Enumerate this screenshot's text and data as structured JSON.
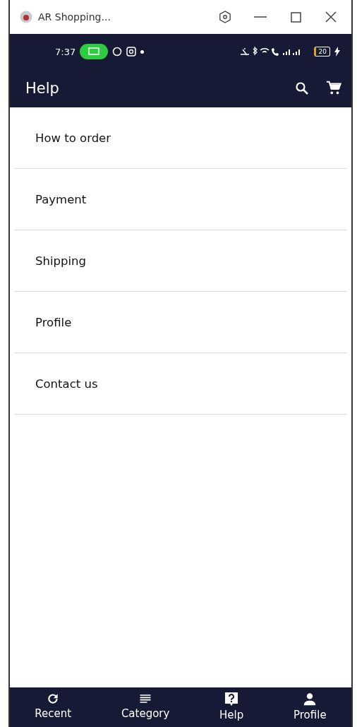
{
  "window": {
    "title": "AR Shopping..."
  },
  "status_bar": {
    "time": "7:37",
    "battery": "20"
  },
  "app_bar": {
    "title": "Help"
  },
  "help_items": [
    {
      "label": "How to order"
    },
    {
      "label": "Payment"
    },
    {
      "label": "Shipping"
    },
    {
      "label": "Profile"
    },
    {
      "label": "Contact us"
    }
  ],
  "bottom_nav": [
    {
      "label": "Recent",
      "kind": "recent"
    },
    {
      "label": "Category",
      "kind": "category"
    },
    {
      "label": "Help",
      "kind": "help"
    },
    {
      "label": "Profile",
      "kind": "profile"
    }
  ]
}
